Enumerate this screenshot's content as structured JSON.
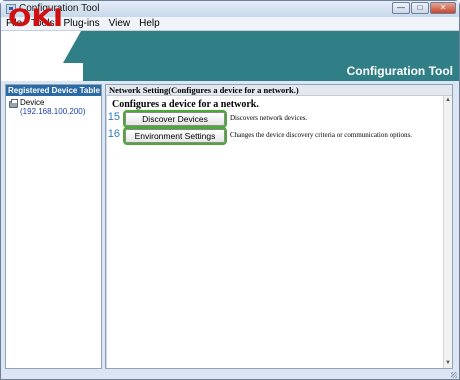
{
  "window": {
    "title": "Configuration Tool",
    "controls": {
      "minimize": "—",
      "maximize": "□",
      "close": "✕"
    }
  },
  "menu": [
    "File",
    "Tools",
    "Plug-ins",
    "View",
    "Help"
  ],
  "banner": {
    "logo": "OKI",
    "app_title": "Configuration Tool",
    "logo_color": "#d01010",
    "accent_color": "#317f86"
  },
  "left_panel": {
    "header": "Registered Device Table",
    "device": {
      "name": "Device",
      "ip": "(192.168.100.200)"
    }
  },
  "right_panel": {
    "header": "Network Setting(Configures a device for a network.)",
    "heading": "Configures a device for a network.",
    "actions": [
      {
        "callout": "15",
        "label": "Discover Devices",
        "description": "Discovers network devices."
      },
      {
        "callout": "16",
        "label": "Environment Settings",
        "description": "Changes the device discovery criteria or communication options."
      }
    ],
    "highlight_color": "#4aaa35"
  },
  "scrollbar": {
    "up": "▲",
    "down": "▼"
  }
}
